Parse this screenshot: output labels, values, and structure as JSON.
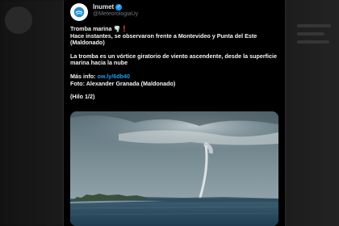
{
  "tweet": {
    "author_name": "Inumet",
    "author_handle": "@MeteorologiaUy",
    "verified": true,
    "line1": "Tromba marina 🌪️❗",
    "line2": "Hace instantes, se observaron frente a Montevideo y Punta del Este (Maldonado)",
    "paragraph2": "La tromba es un vórtice giratorio de viento ascendente, desde la superficie marina hacia la nube",
    "more_info_label": "Más info:",
    "more_info_link": "ow.ly/6db40",
    "photo_credit": "Foto: Alexander Granada (Maldonado)",
    "thread_index": "(Hilo 1/2)"
  },
  "colors": {
    "link": "#1d9bf0",
    "verified_badge": "#1d9bf0",
    "card_bg": "#000000"
  },
  "icons": {
    "avatar": "inumet-logo",
    "verified": "verified-badge-icon"
  }
}
